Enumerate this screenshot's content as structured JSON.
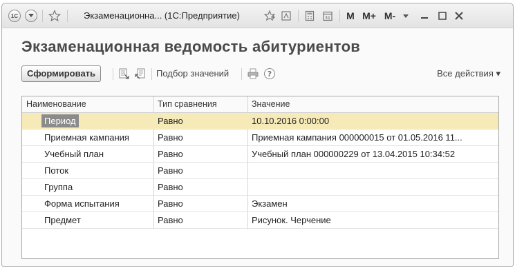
{
  "window": {
    "title": "Экзаменационна... (1С:Предприятие)",
    "toolbar_labels": {
      "m": "M",
      "m_plus": "M+",
      "m_minus": "M-"
    },
    "icons": [
      "app-logo-icon",
      "menu-arrow-icon",
      "favorite-star-icon",
      "add-favorite-icon",
      "history-icon",
      "calculator-icon",
      "calendar-icon",
      "dropdown-icon",
      "minimize-icon",
      "maximize-icon",
      "close-icon"
    ]
  },
  "form": {
    "title": "Экзаменационная ведомость абитуриентов",
    "generate_label": "Сформировать",
    "select_values_label": "Подбор значений",
    "all_actions_label": "Все действия ▾"
  },
  "table": {
    "columns": [
      "Наименование",
      "Тип сравнения",
      "Значение"
    ],
    "rows": [
      {
        "name": "Период",
        "comparison": "Равно",
        "value": "10.10.2016 0:00:00",
        "selected": true
      },
      {
        "name": "Приемная кампания",
        "comparison": "Равно",
        "value": "Приемная кампания 000000015 от 01.05.2016 11..."
      },
      {
        "name": "Учебный план",
        "comparison": "Равно",
        "value": "Учебный план 000000229 от 13.04.2015 10:34:52"
      },
      {
        "name": "Поток",
        "comparison": "Равно",
        "value": ""
      },
      {
        "name": "Группа",
        "comparison": "Равно",
        "value": ""
      },
      {
        "name": "Форма испытания",
        "comparison": "Равно",
        "value": "Экзамен"
      },
      {
        "name": "Предмет",
        "comparison": "Равно",
        "value": "Рисунок. Черчение"
      }
    ]
  },
  "colors": {
    "selected_row": "#f6ebb8",
    "highlight": "#8b8b8b"
  }
}
